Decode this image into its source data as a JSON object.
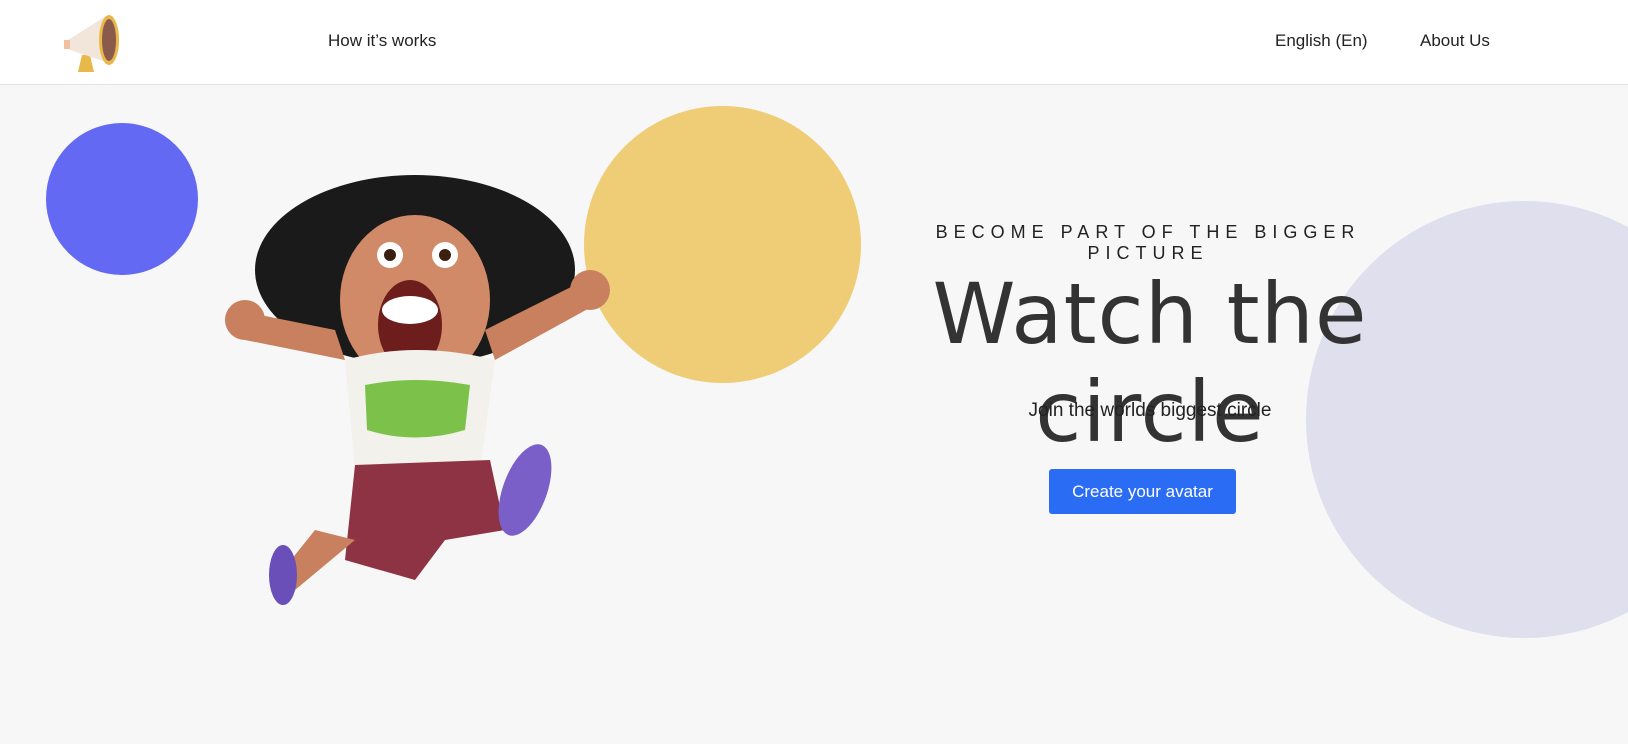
{
  "header": {
    "logo_icon": "megaphone-icon",
    "nav_left": [
      {
        "label": "How it’s works"
      }
    ],
    "nav_right": [
      {
        "label": "English (En)"
      },
      {
        "label": "About Us"
      }
    ]
  },
  "hero": {
    "eyebrow": "BECOME PART OF THE BIGGER PICTURE",
    "title": "Watch the circle",
    "tagline": "Join the worlds biggest circle",
    "cta_label": "Create your avatar",
    "illustration": "jumping-girl-cartoon"
  },
  "colors": {
    "accent": "#2a6cf4",
    "circle_blue": "#6369f2",
    "circle_yellow": "#efcc76",
    "circle_lavender": "#e0dfee"
  }
}
